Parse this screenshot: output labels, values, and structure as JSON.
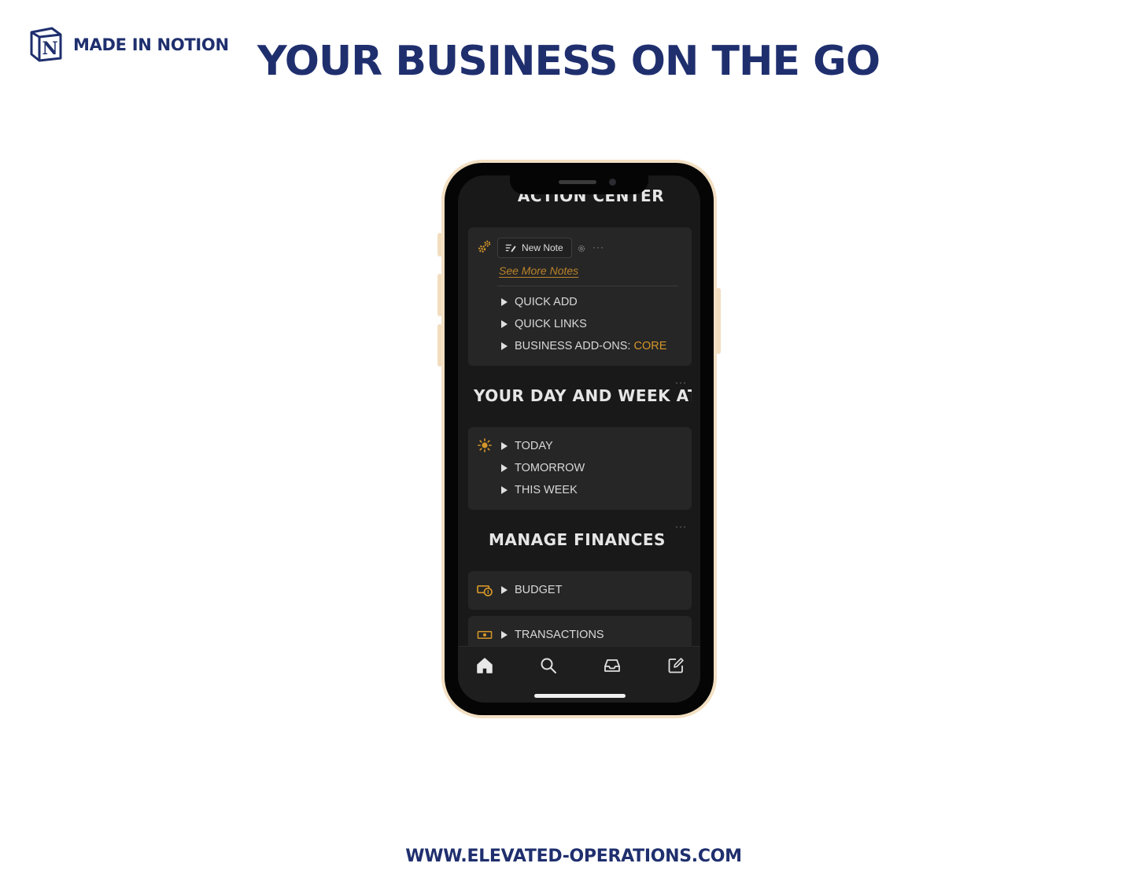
{
  "brand": {
    "label": "MADE IN NOTION",
    "logo_letter": "N"
  },
  "headline": "YOUR BUSINESS ON THE GO",
  "footer": {
    "url": "WWW.ELEVATED-OPERATIONS.COM"
  },
  "colors": {
    "navy": "#1f2f6e",
    "accent": "#d4962a",
    "screen_bg": "#191919",
    "card_bg": "#262626",
    "phone_gold": "#f3e0c3"
  },
  "screen": {
    "action_center": {
      "title": "ACTION CENTER",
      "icon": "gears-icon",
      "new_note_label": "New Note",
      "see_more_label": "See More Notes",
      "toggles": [
        "QUICK ADD",
        "QUICK LINKS"
      ],
      "addons_label": "BUSINESS ADD-ONS: ",
      "addons_value": "CORE"
    },
    "day_week": {
      "title": "YOUR DAY AND WEEK AT A GLANCE",
      "icon": "sun-icon",
      "toggles": [
        "TODAY",
        "TOMORROW",
        "THIS WEEK"
      ]
    },
    "finances": {
      "title": "MANAGE FINANCES",
      "budget_label": "BUDGET",
      "budget_icon": "money-icon",
      "transactions_label": "TRANSACTIONS",
      "transactions_icon": "cash-icon"
    },
    "tabbar": [
      "home-icon",
      "search-icon",
      "inbox-icon",
      "compose-icon"
    ]
  }
}
